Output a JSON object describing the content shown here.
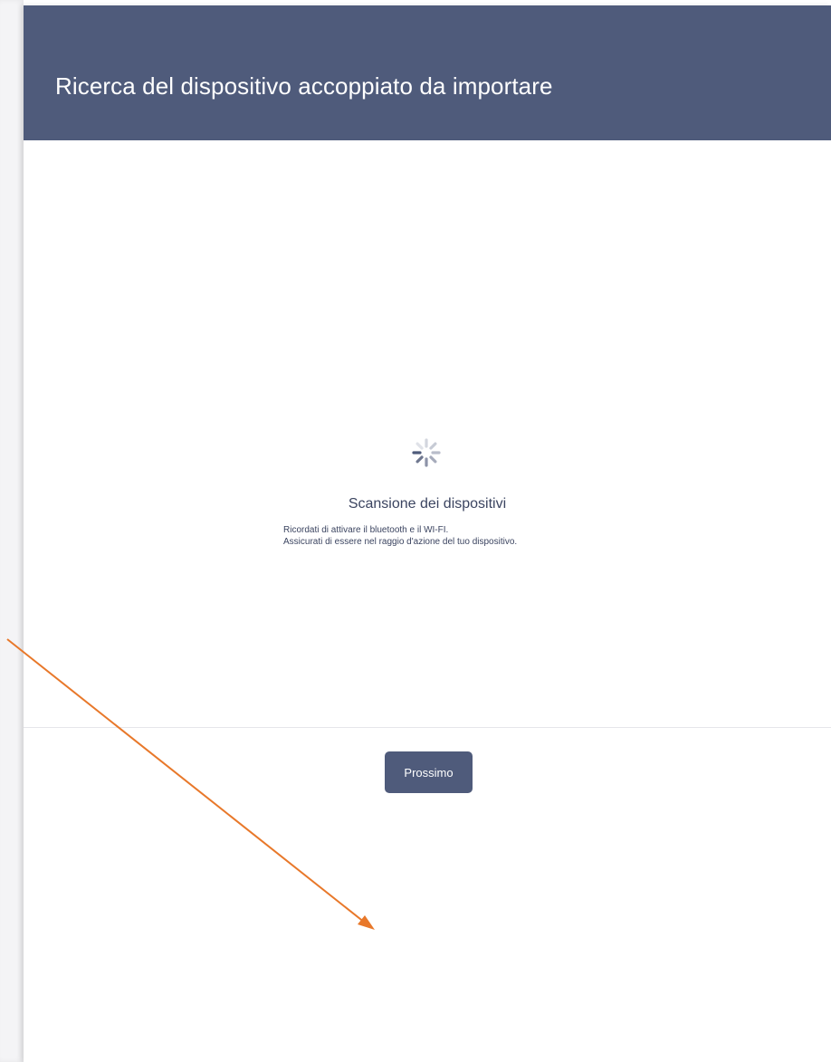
{
  "header": {
    "title": "Ricerca del dispositivo accoppiato da importare"
  },
  "scan": {
    "title": "Scansione dei dispositivi",
    "hint_line_1": "Ricordati di attivare il bluetooth e il WI-FI.",
    "hint_line_2": "Assicurati di essere nel raggio d'azione del tuo dispositivo.",
    "spinner_icon": "loading-spinner-icon"
  },
  "footer": {
    "next_label": "Prossimo"
  },
  "annotation": {
    "icon": "arrow-pointer-icon"
  },
  "colors": {
    "header_bg": "#4f5b7b",
    "button_bg": "#4f5b7b",
    "text_dark": "#3b4460",
    "annotation_arrow": "#e8782a"
  }
}
